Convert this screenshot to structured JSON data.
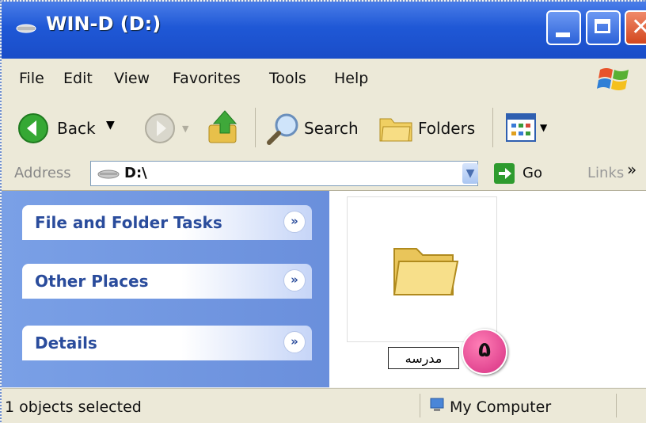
{
  "window": {
    "title": "WIN-D (D:)"
  },
  "menu": [
    {
      "label": "File"
    },
    {
      "label": "Edit"
    },
    {
      "label": "View"
    },
    {
      "label": "Favorites"
    },
    {
      "label": "Tools"
    },
    {
      "label": "Help"
    }
  ],
  "toolbar": {
    "back": "Back",
    "search": "Search",
    "folders": "Folders"
  },
  "address": {
    "label": "Address",
    "value": "D:\\",
    "go": "Go",
    "links": "Links",
    "more": "»"
  },
  "tasks": [
    {
      "label": "File and Folder Tasks"
    },
    {
      "label": "Other Places"
    },
    {
      "label": "Details"
    }
  ],
  "chevron_glyph": "»",
  "folder": {
    "name": "مدرسه"
  },
  "callout": {
    "number": "۵"
  },
  "status": {
    "left": "1 objects selected",
    "location": "My Computer"
  },
  "colors": {
    "titlebar": "#1f58d6",
    "leftpane": "#6a8fdc",
    "callout": "#d62f82"
  }
}
